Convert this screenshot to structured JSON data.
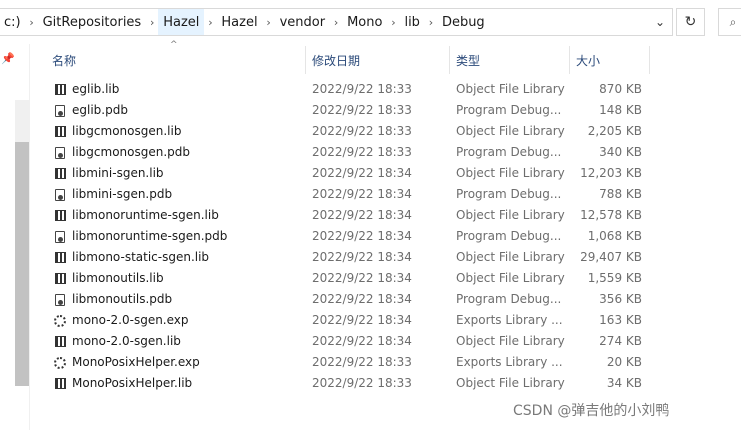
{
  "address_bar": {
    "crumbs": [
      "c:)",
      "GitRepositories",
      "Hazel",
      "Hazel",
      "vendor",
      "Mono",
      "lib",
      "Debug"
    ]
  },
  "columns": {
    "name": "名称",
    "modified": "修改日期",
    "type": "类型",
    "size": "大小"
  },
  "files": [
    {
      "name": "eglib.lib",
      "modified": "2022/9/22 18:33",
      "type": "Object File Library",
      "size": "870 KB",
      "icon": "lib-file-icon"
    },
    {
      "name": "eglib.pdb",
      "modified": "2022/9/22 18:33",
      "type": "Program Debug...",
      "size": "148 KB",
      "icon": "pdb-file-icon"
    },
    {
      "name": "libgcmonosgen.lib",
      "modified": "2022/9/22 18:33",
      "type": "Object File Library",
      "size": "2,205 KB",
      "icon": "lib-file-icon"
    },
    {
      "name": "libgcmonosgen.pdb",
      "modified": "2022/9/22 18:33",
      "type": "Program Debug...",
      "size": "340 KB",
      "icon": "pdb-file-icon"
    },
    {
      "name": "libmini-sgen.lib",
      "modified": "2022/9/22 18:34",
      "type": "Object File Library",
      "size": "12,203 KB",
      "icon": "lib-file-icon"
    },
    {
      "name": "libmini-sgen.pdb",
      "modified": "2022/9/22 18:34",
      "type": "Program Debug...",
      "size": "788 KB",
      "icon": "pdb-file-icon"
    },
    {
      "name": "libmonoruntime-sgen.lib",
      "modified": "2022/9/22 18:34",
      "type": "Object File Library",
      "size": "12,578 KB",
      "icon": "lib-file-icon"
    },
    {
      "name": "libmonoruntime-sgen.pdb",
      "modified": "2022/9/22 18:34",
      "type": "Program Debug...",
      "size": "1,068 KB",
      "icon": "pdb-file-icon"
    },
    {
      "name": "libmono-static-sgen.lib",
      "modified": "2022/9/22 18:34",
      "type": "Object File Library",
      "size": "29,407 KB",
      "icon": "lib-file-icon"
    },
    {
      "name": "libmonoutils.lib",
      "modified": "2022/9/22 18:34",
      "type": "Object File Library",
      "size": "1,559 KB",
      "icon": "lib-file-icon"
    },
    {
      "name": "libmonoutils.pdb",
      "modified": "2022/9/22 18:34",
      "type": "Program Debug...",
      "size": "356 KB",
      "icon": "pdb-file-icon"
    },
    {
      "name": "mono-2.0-sgen.exp",
      "modified": "2022/9/22 18:34",
      "type": "Exports Library ...",
      "size": "163 KB",
      "icon": "exp-file-icon"
    },
    {
      "name": "mono-2.0-sgen.lib",
      "modified": "2022/9/22 18:34",
      "type": "Object File Library",
      "size": "274 KB",
      "icon": "lib-file-icon"
    },
    {
      "name": "MonoPosixHelper.exp",
      "modified": "2022/9/22 18:33",
      "type": "Exports Library ...",
      "size": "20 KB",
      "icon": "exp-file-icon"
    },
    {
      "name": "MonoPosixHelper.lib",
      "modified": "2022/9/22 18:33",
      "type": "Object File Library",
      "size": "34 KB",
      "icon": "lib-file-icon"
    }
  ],
  "watermark": "CSDN @弹吉他的小刘鸭",
  "colors": {
    "header_text": "#2b4a7a",
    "secondary_text": "#6d6d6d",
    "crumb_highlight": "#e5f3ff"
  }
}
